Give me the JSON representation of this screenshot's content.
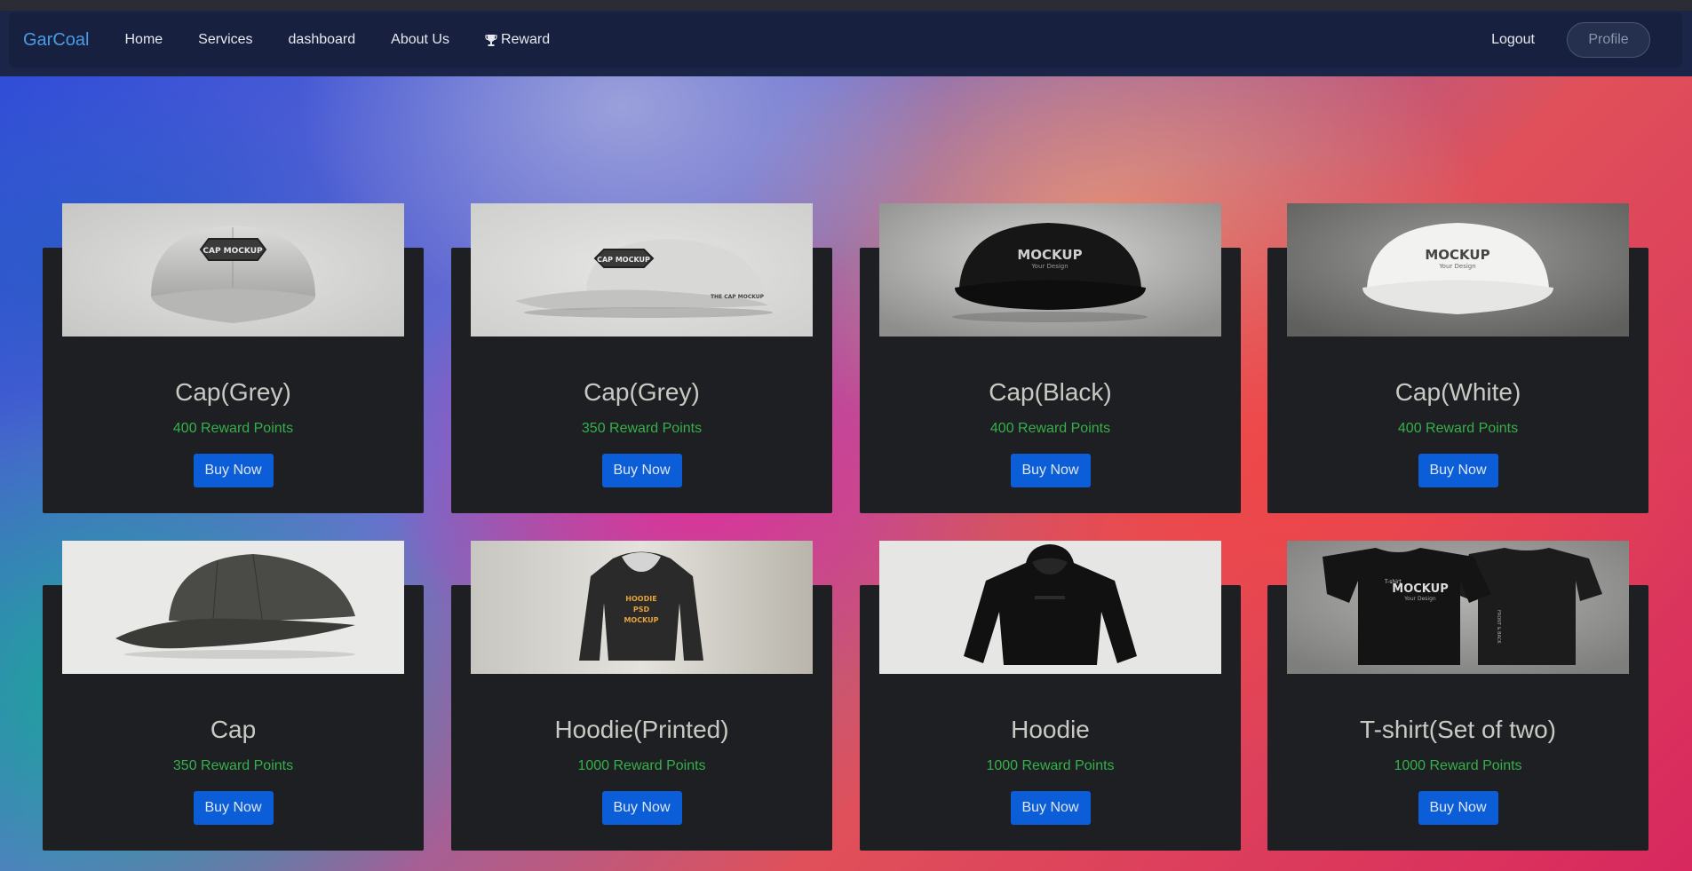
{
  "nav": {
    "brand": "GarCoal",
    "items": [
      {
        "label": "Home"
      },
      {
        "label": "Services"
      },
      {
        "label": "dashboard"
      },
      {
        "label": "About Us"
      },
      {
        "label": "Reward",
        "icon": "trophy-icon"
      }
    ],
    "logout": "Logout",
    "profile": "Profile"
  },
  "products": [
    {
      "title": "Cap(Grey)",
      "points": "400 Reward Points",
      "button": "Buy Now",
      "image_text": "CAP MOCKUP"
    },
    {
      "title": "Cap(Grey)",
      "points": "350 Reward Points",
      "button": "Buy Now",
      "image_text": "CAP MOCKUP",
      "image_text2": "THE CAP MOCKUP"
    },
    {
      "title": "Cap(Black)",
      "points": "400 Reward Points",
      "button": "Buy Now",
      "image_text": "MOCKUP",
      "image_text2": "Your Design"
    },
    {
      "title": "Cap(White)",
      "points": "400 Reward Points",
      "button": "Buy Now",
      "image_text": "MOCKUP",
      "image_text2": "Your Design"
    },
    {
      "title": "Cap",
      "points": "350 Reward Points",
      "button": "Buy Now"
    },
    {
      "title": "Hoodie(Printed)",
      "points": "1000 Reward Points",
      "button": "Buy Now",
      "image_text": "HOODIE",
      "image_text2": "PSD",
      "image_text3": "MOCKUP"
    },
    {
      "title": "Hoodie",
      "points": "1000 Reward Points",
      "button": "Buy Now"
    },
    {
      "title": "T-shirt(Set of two)",
      "points": "1000 Reward Points",
      "button": "Buy Now",
      "image_text": "MOCKUP",
      "image_text2": "Your Design",
      "image_text3": "FRONT & BACK",
      "image_text4": "T-shirt"
    }
  ],
  "colors": {
    "brand": "#4a9be6",
    "points": "#36b04a",
    "button": "#0b5ed7",
    "card": "#1d1f22"
  }
}
